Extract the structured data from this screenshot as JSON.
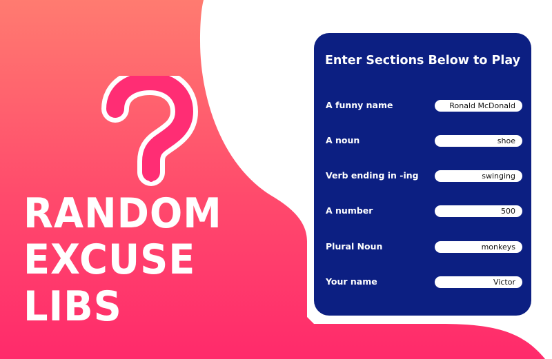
{
  "title": {
    "line1": "RANDOM",
    "line2": "EXCUSE",
    "line3": "LIBS"
  },
  "form": {
    "heading": "Enter Sections Below to Play",
    "fields": [
      {
        "label": "A funny name",
        "value": "Ronald McDonald"
      },
      {
        "label": "A noun",
        "value": "shoe"
      },
      {
        "label": "Verb ending in -ing",
        "value": "swinging"
      },
      {
        "label": "A number",
        "value": "500"
      },
      {
        "label": "Plural Noun",
        "value": "monkeys"
      },
      {
        "label": "Your name",
        "value": "Victor"
      }
    ]
  },
  "colors": {
    "gradient_top": "#ff7a6e",
    "gradient_bottom": "#ff2c6c",
    "question_mark": "#ff2d74",
    "panel": "#0c1f82",
    "white": "#ffffff"
  },
  "icons": {
    "question_mark": "question-mark-icon"
  }
}
